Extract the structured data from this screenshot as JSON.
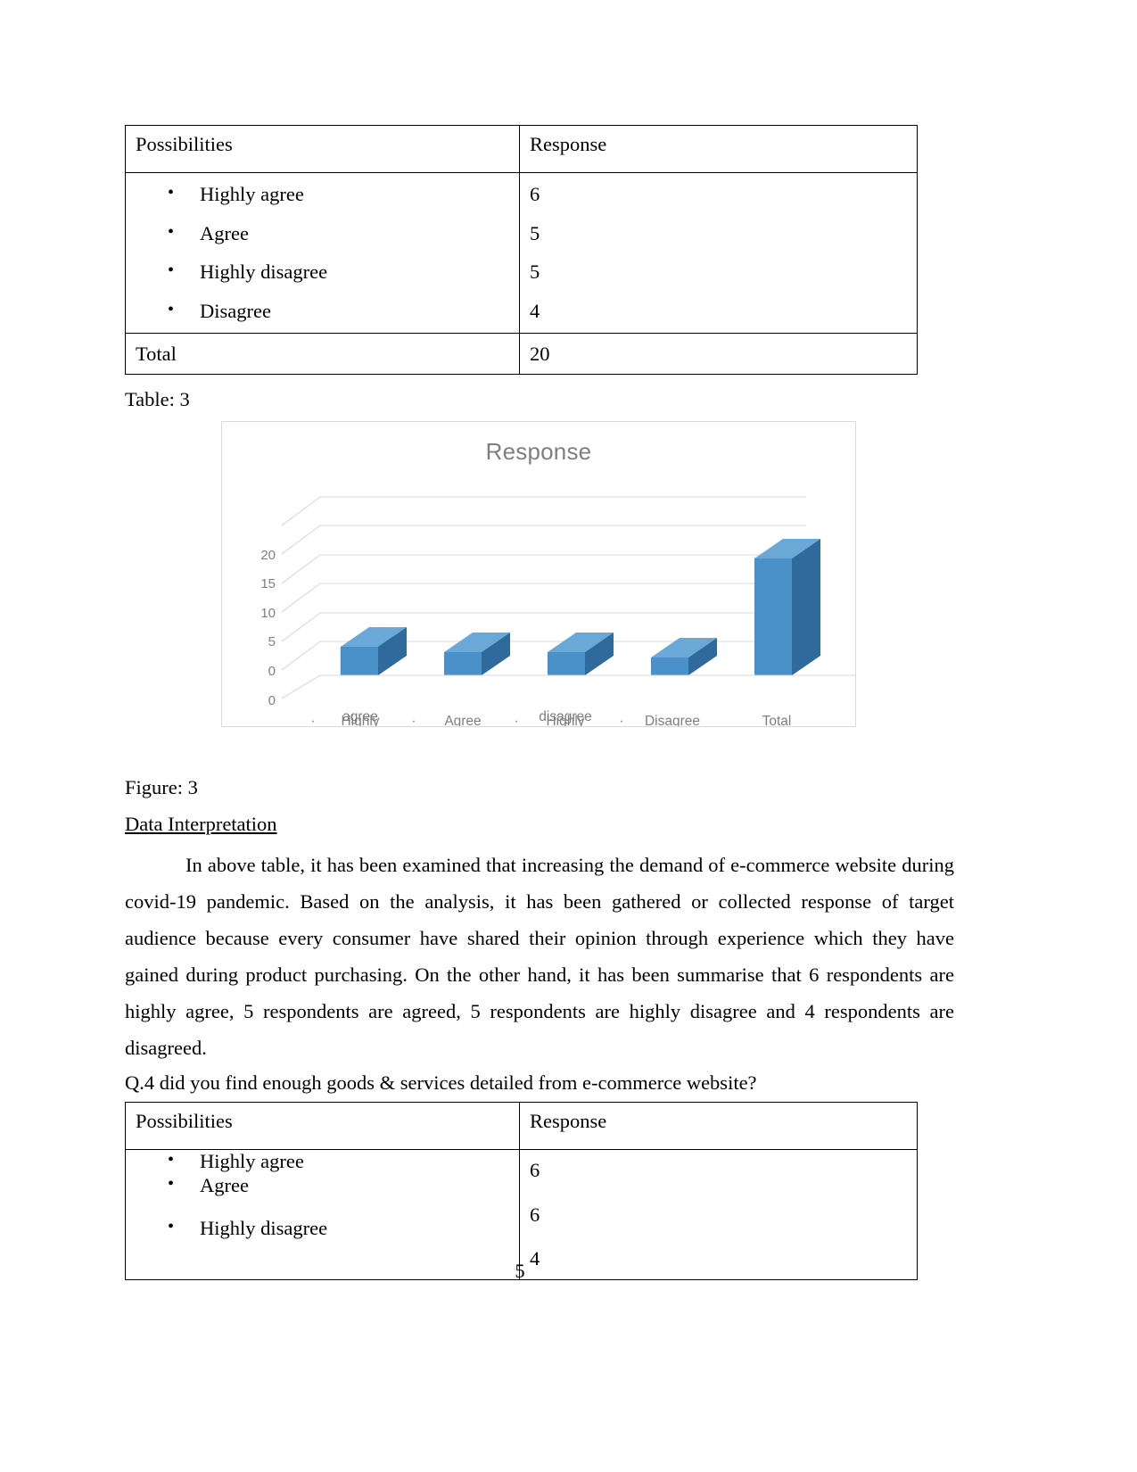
{
  "document": {
    "page_number": "5"
  },
  "table1": {
    "name": "table-3",
    "headers": [
      "Possibilities",
      "Response"
    ],
    "rows": [
      {
        "label": "Highly agree",
        "value": "6"
      },
      {
        "label": "Agree",
        "value": "5"
      },
      {
        "label": "Highly disagree",
        "value": "5"
      },
      {
        "label": "Disagree",
        "value": "4"
      }
    ],
    "total_label": "Total",
    "total_value": "20",
    "caption": "Table: 3"
  },
  "figure": {
    "caption": "Figure: 3"
  },
  "chart_data": {
    "type": "bar",
    "title": "Response",
    "categories": [
      "Highly agree",
      "Agree",
      "Highly disagree",
      "Disagree",
      "Total"
    ],
    "category_line1": [
      "Highly",
      "Agree",
      "Highly",
      "",
      "Total"
    ],
    "category_line2": [
      "agree",
      "",
      "disagree",
      "Disagree",
      ""
    ],
    "values": [
      6,
      5,
      5,
      4,
      20
    ],
    "xlabel": "",
    "ylabel": "",
    "ylim": [
      0,
      20
    ],
    "yticks": [
      "0",
      "5",
      "10",
      "15",
      "20"
    ],
    "grid": true,
    "legend": "none",
    "three_d": true,
    "bar_color": "#4a90c9",
    "bar_side_color": "#2f6a9c",
    "bar_top_color": "#6aa8d8",
    "title_color": "#7f7f7f",
    "tick_color": "#7f7f7f",
    "gridline_color": "#d9d9d9",
    "border_color": "#d9d9d9"
  },
  "interpretation": {
    "heading": "Data Interpretation ",
    "paragraph": "In above table, it has been examined that increasing the demand of e-commerce website during covid-19 pandemic. Based on the analysis, it has been gathered or collected response of target audience because every consumer have shared their opinion through experience which they have gained during product purchasing. On the other hand, it has been summarise that 6 respondents are highly agree, 5 respondents are agreed, 5 respondents are highly disagree and 4 respondents are disagreed."
  },
  "question4": {
    "text": "Q.4 did you find enough goods & services detailed from e-commerce website?"
  },
  "table2": {
    "headers": [
      "Possibilities",
      "Response"
    ],
    "rows": [
      {
        "label": "Highly agree",
        "value": "6"
      },
      {
        "label": "Agree",
        "value": "6"
      },
      {
        "label": "Highly disagree",
        "value": "4"
      }
    ]
  },
  "icons": {
    "bullet": "•"
  }
}
